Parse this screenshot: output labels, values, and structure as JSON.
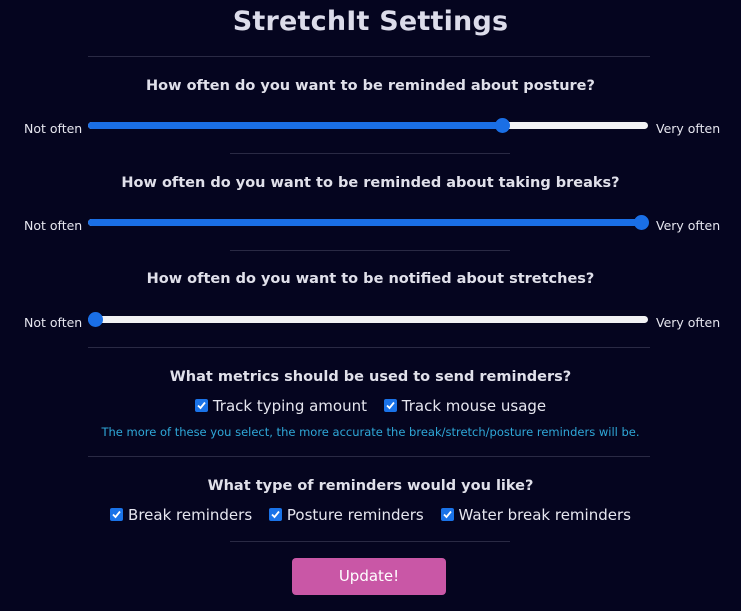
{
  "title": "StretchIt Settings",
  "colors": {
    "background": "#05051f",
    "accent_blue": "#1a6fe6",
    "hint_text": "#2fa8d8",
    "button": "#c957a6"
  },
  "sliders": [
    {
      "question": "How often do you want to be reminded about posture?",
      "min_label": "Not often",
      "max_label": "Very often",
      "value_fraction": 0.745
    },
    {
      "question": "How often do you want to be reminded about taking breaks?",
      "min_label": "Not often",
      "max_label": "Very often",
      "value_fraction": 1.0
    },
    {
      "question": "How often do you want to be notified about stretches?",
      "min_label": "Not often",
      "max_label": "Very often",
      "value_fraction": 0.0
    }
  ],
  "metrics": {
    "question": "What metrics should be used to send reminders?",
    "options": [
      {
        "label": "Track typing amount",
        "checked": true
      },
      {
        "label": "Track mouse usage",
        "checked": true
      }
    ],
    "hint": "The more of these you select, the more accurate the break/stretch/posture reminders will be."
  },
  "reminder_types": {
    "question": "What type of reminders would you like?",
    "options": [
      {
        "label": "Break reminders",
        "checked": true
      },
      {
        "label": "Posture reminders",
        "checked": true
      },
      {
        "label": "Water break reminders",
        "checked": true
      }
    ]
  },
  "update_label": "Update!"
}
